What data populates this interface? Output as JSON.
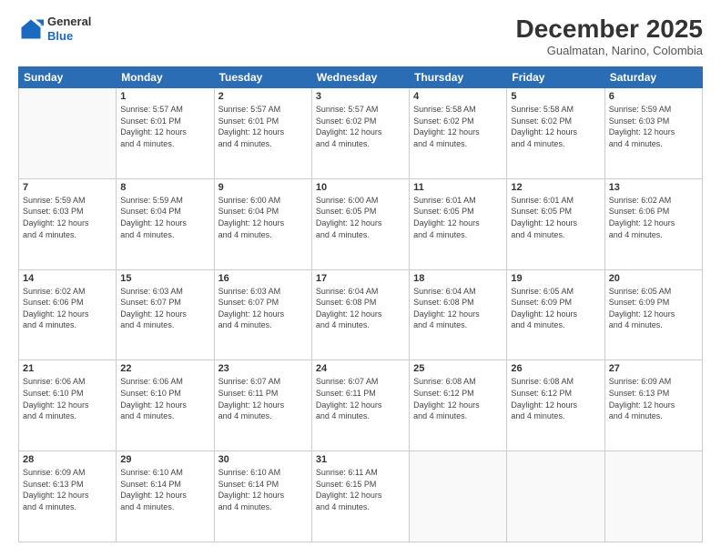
{
  "logo": {
    "line1": "General",
    "line2": "Blue"
  },
  "title": "December 2025",
  "subtitle": "Gualmatan, Narino, Colombia",
  "weekdays": [
    "Sunday",
    "Monday",
    "Tuesday",
    "Wednesday",
    "Thursday",
    "Friday",
    "Saturday"
  ],
  "weeks": [
    [
      {
        "day": "",
        "info": ""
      },
      {
        "day": "1",
        "info": "Sunrise: 5:57 AM\nSunset: 6:01 PM\nDaylight: 12 hours\nand 4 minutes."
      },
      {
        "day": "2",
        "info": "Sunrise: 5:57 AM\nSunset: 6:01 PM\nDaylight: 12 hours\nand 4 minutes."
      },
      {
        "day": "3",
        "info": "Sunrise: 5:57 AM\nSunset: 6:02 PM\nDaylight: 12 hours\nand 4 minutes."
      },
      {
        "day": "4",
        "info": "Sunrise: 5:58 AM\nSunset: 6:02 PM\nDaylight: 12 hours\nand 4 minutes."
      },
      {
        "day": "5",
        "info": "Sunrise: 5:58 AM\nSunset: 6:02 PM\nDaylight: 12 hours\nand 4 minutes."
      },
      {
        "day": "6",
        "info": "Sunrise: 5:59 AM\nSunset: 6:03 PM\nDaylight: 12 hours\nand 4 minutes."
      }
    ],
    [
      {
        "day": "7",
        "info": "Sunrise: 5:59 AM\nSunset: 6:03 PM\nDaylight: 12 hours\nand 4 minutes."
      },
      {
        "day": "8",
        "info": "Sunrise: 5:59 AM\nSunset: 6:04 PM\nDaylight: 12 hours\nand 4 minutes."
      },
      {
        "day": "9",
        "info": "Sunrise: 6:00 AM\nSunset: 6:04 PM\nDaylight: 12 hours\nand 4 minutes."
      },
      {
        "day": "10",
        "info": "Sunrise: 6:00 AM\nSunset: 6:05 PM\nDaylight: 12 hours\nand 4 minutes."
      },
      {
        "day": "11",
        "info": "Sunrise: 6:01 AM\nSunset: 6:05 PM\nDaylight: 12 hours\nand 4 minutes."
      },
      {
        "day": "12",
        "info": "Sunrise: 6:01 AM\nSunset: 6:05 PM\nDaylight: 12 hours\nand 4 minutes."
      },
      {
        "day": "13",
        "info": "Sunrise: 6:02 AM\nSunset: 6:06 PM\nDaylight: 12 hours\nand 4 minutes."
      }
    ],
    [
      {
        "day": "14",
        "info": "Sunrise: 6:02 AM\nSunset: 6:06 PM\nDaylight: 12 hours\nand 4 minutes."
      },
      {
        "day": "15",
        "info": "Sunrise: 6:03 AM\nSunset: 6:07 PM\nDaylight: 12 hours\nand 4 minutes."
      },
      {
        "day": "16",
        "info": "Sunrise: 6:03 AM\nSunset: 6:07 PM\nDaylight: 12 hours\nand 4 minutes."
      },
      {
        "day": "17",
        "info": "Sunrise: 6:04 AM\nSunset: 6:08 PM\nDaylight: 12 hours\nand 4 minutes."
      },
      {
        "day": "18",
        "info": "Sunrise: 6:04 AM\nSunset: 6:08 PM\nDaylight: 12 hours\nand 4 minutes."
      },
      {
        "day": "19",
        "info": "Sunrise: 6:05 AM\nSunset: 6:09 PM\nDaylight: 12 hours\nand 4 minutes."
      },
      {
        "day": "20",
        "info": "Sunrise: 6:05 AM\nSunset: 6:09 PM\nDaylight: 12 hours\nand 4 minutes."
      }
    ],
    [
      {
        "day": "21",
        "info": "Sunrise: 6:06 AM\nSunset: 6:10 PM\nDaylight: 12 hours\nand 4 minutes."
      },
      {
        "day": "22",
        "info": "Sunrise: 6:06 AM\nSunset: 6:10 PM\nDaylight: 12 hours\nand 4 minutes."
      },
      {
        "day": "23",
        "info": "Sunrise: 6:07 AM\nSunset: 6:11 PM\nDaylight: 12 hours\nand 4 minutes."
      },
      {
        "day": "24",
        "info": "Sunrise: 6:07 AM\nSunset: 6:11 PM\nDaylight: 12 hours\nand 4 minutes."
      },
      {
        "day": "25",
        "info": "Sunrise: 6:08 AM\nSunset: 6:12 PM\nDaylight: 12 hours\nand 4 minutes."
      },
      {
        "day": "26",
        "info": "Sunrise: 6:08 AM\nSunset: 6:12 PM\nDaylight: 12 hours\nand 4 minutes."
      },
      {
        "day": "27",
        "info": "Sunrise: 6:09 AM\nSunset: 6:13 PM\nDaylight: 12 hours\nand 4 minutes."
      }
    ],
    [
      {
        "day": "28",
        "info": "Sunrise: 6:09 AM\nSunset: 6:13 PM\nDaylight: 12 hours\nand 4 minutes."
      },
      {
        "day": "29",
        "info": "Sunrise: 6:10 AM\nSunset: 6:14 PM\nDaylight: 12 hours\nand 4 minutes."
      },
      {
        "day": "30",
        "info": "Sunrise: 6:10 AM\nSunset: 6:14 PM\nDaylight: 12 hours\nand 4 minutes."
      },
      {
        "day": "31",
        "info": "Sunrise: 6:11 AM\nSunset: 6:15 PM\nDaylight: 12 hours\nand 4 minutes."
      },
      {
        "day": "",
        "info": ""
      },
      {
        "day": "",
        "info": ""
      },
      {
        "day": "",
        "info": ""
      }
    ]
  ]
}
